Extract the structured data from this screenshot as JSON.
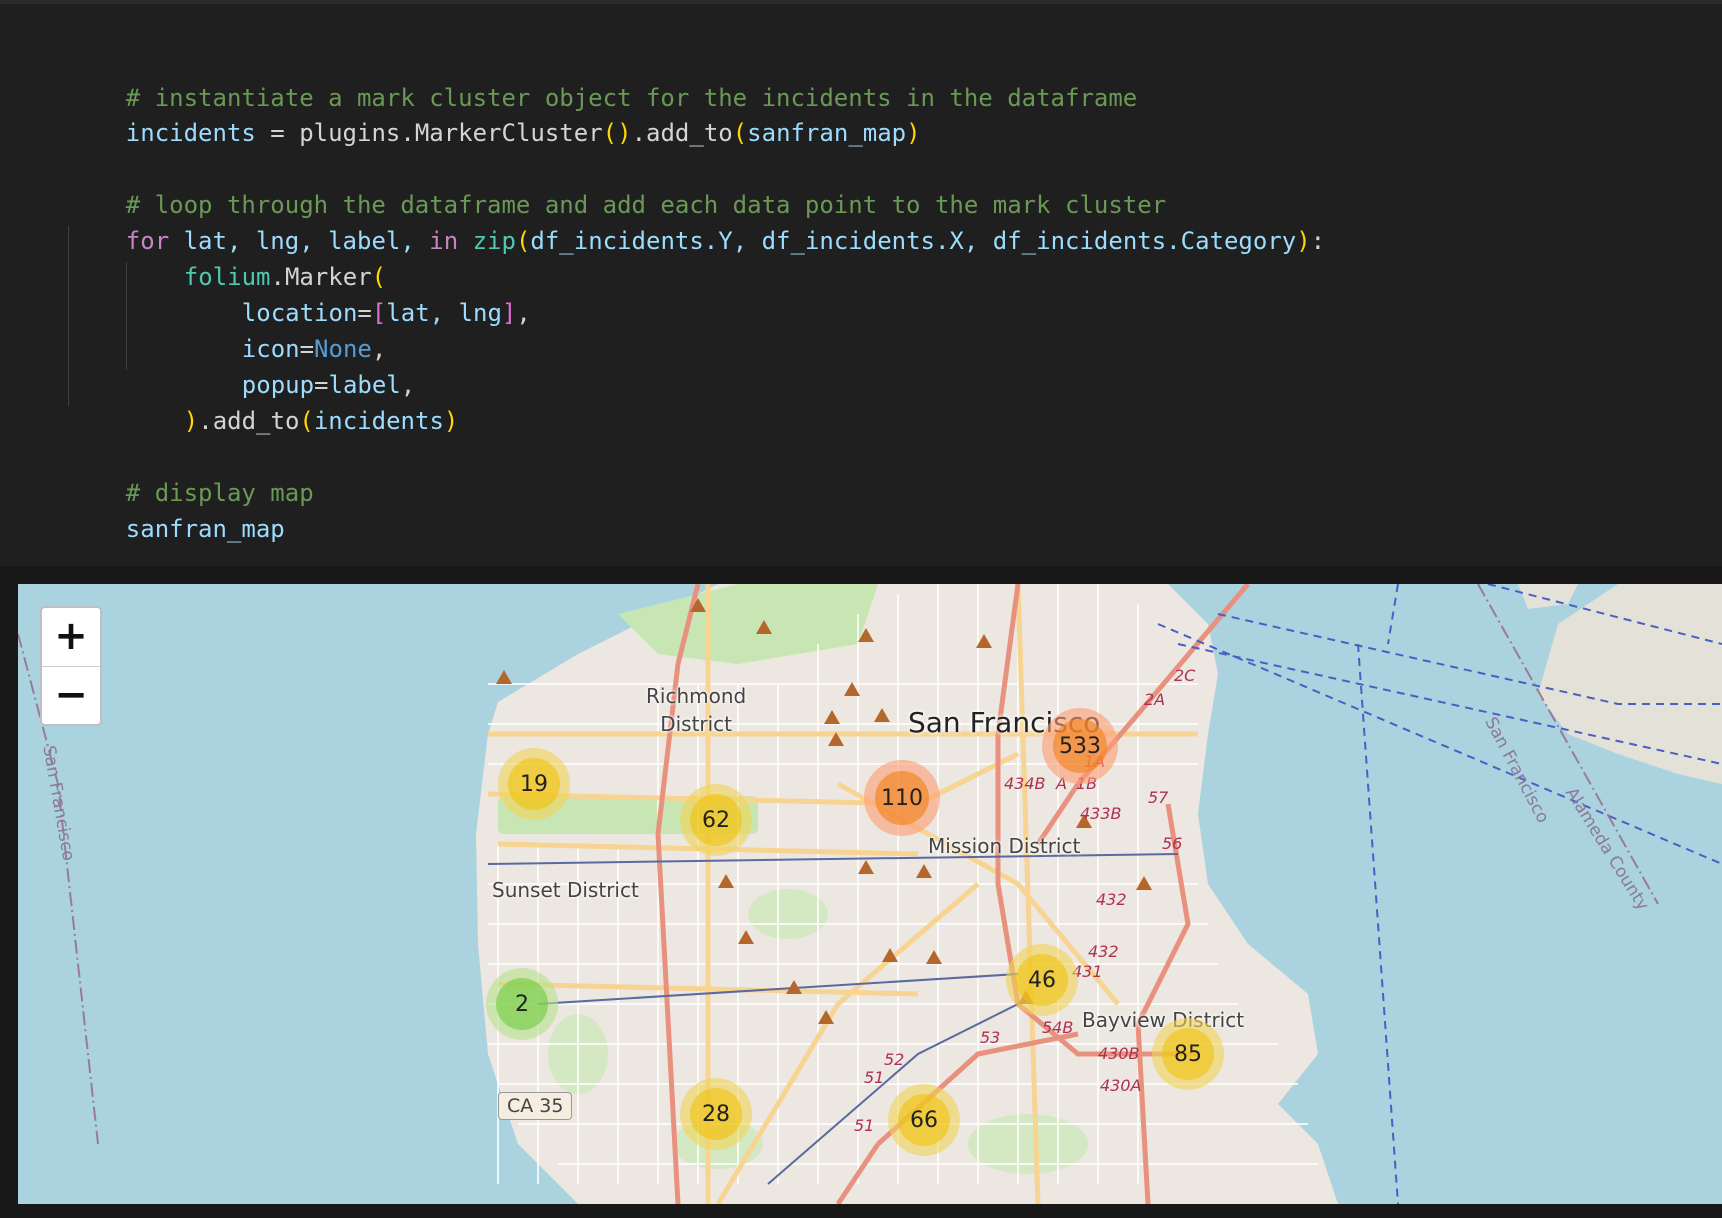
{
  "code": {
    "comment_cluster": "# instantiate a mark cluster object for the incidents in the dataframe",
    "l2_var": "incidents",
    "l2_eq": " = ",
    "l2_obj": "plugins",
    "l2_dot1": ".",
    "l2_fn": "MarkerCluster",
    "l2_paren_open": "()",
    "l2_dot2": ".",
    "l2_fn2": "add_to",
    "l2_p_open": "(",
    "l2_arg": "sanfran_map",
    "l2_p_close": ")",
    "comment_loop": "# loop through the dataframe and add each data point to the mark cluster",
    "for_kw": "for",
    "for_vars": " lat, lng, label, ",
    "in_kw": "in",
    "zip_fn": " zip",
    "zip_open": "(",
    "zip_args": "df_incidents.Y, df_incidents.X, df_incidents.Category",
    "zip_close": ")",
    "colon": ":",
    "marker_mod": "folium",
    "marker_dot": ".",
    "marker_cls": "Marker",
    "marker_open": "(",
    "loc_key": "location",
    "loc_eq": "=",
    "loc_open": "[",
    "loc_vals": "lat, lng",
    "loc_close": "]",
    "loc_comma": ",",
    "icon_key": "icon",
    "icon_eq": "=",
    "icon_val": "None",
    "icon_comma": ",",
    "popup_key": "popup",
    "popup_eq": "=",
    "popup_val": "label",
    "popup_comma": ",",
    "close_paren": ")",
    "close_dot": ".",
    "close_fn": "add_to",
    "close_open": "(",
    "close_arg": "incidents",
    "close_close": ")",
    "comment_display": "# display map",
    "display_var": "sanfran_map"
  },
  "map": {
    "zoom_in": "+",
    "zoom_out": "−",
    "labels": {
      "richmond": "Richmond\nDistrict",
      "sanfrancisco": "San Francisco",
      "mission": "Mission District",
      "sunset": "Sunset District",
      "bayview": "Bayview District",
      "water_left": "San Francisco",
      "water_right": "San Francisco",
      "alameda": "Alameda County",
      "ca35": "CA 35"
    },
    "highway_labels": [
      "2C",
      "2A",
      "1A",
      "434B",
      "A",
      "1B",
      "433B",
      "57",
      "56",
      "432",
      "432",
      "431",
      "53",
      "54B",
      "430B",
      "430A",
      "52",
      "51",
      "51"
    ],
    "clusters": [
      {
        "count": "19",
        "size": "med"
      },
      {
        "count": "62",
        "size": "med"
      },
      {
        "count": "110",
        "size": "large"
      },
      {
        "count": "533",
        "size": "large"
      },
      {
        "count": "2",
        "size": "small"
      },
      {
        "count": "46",
        "size": "med"
      },
      {
        "count": "85",
        "size": "med"
      },
      {
        "count": "28",
        "size": "med"
      },
      {
        "count": "66",
        "size": "med"
      }
    ],
    "colors": {
      "water": "#aad3df",
      "land": "#ece7e0",
      "park": "#c8e6b4",
      "major_road": "#f5c77a",
      "highway": "#e8917f",
      "transit": "#4a5fc1"
    }
  }
}
